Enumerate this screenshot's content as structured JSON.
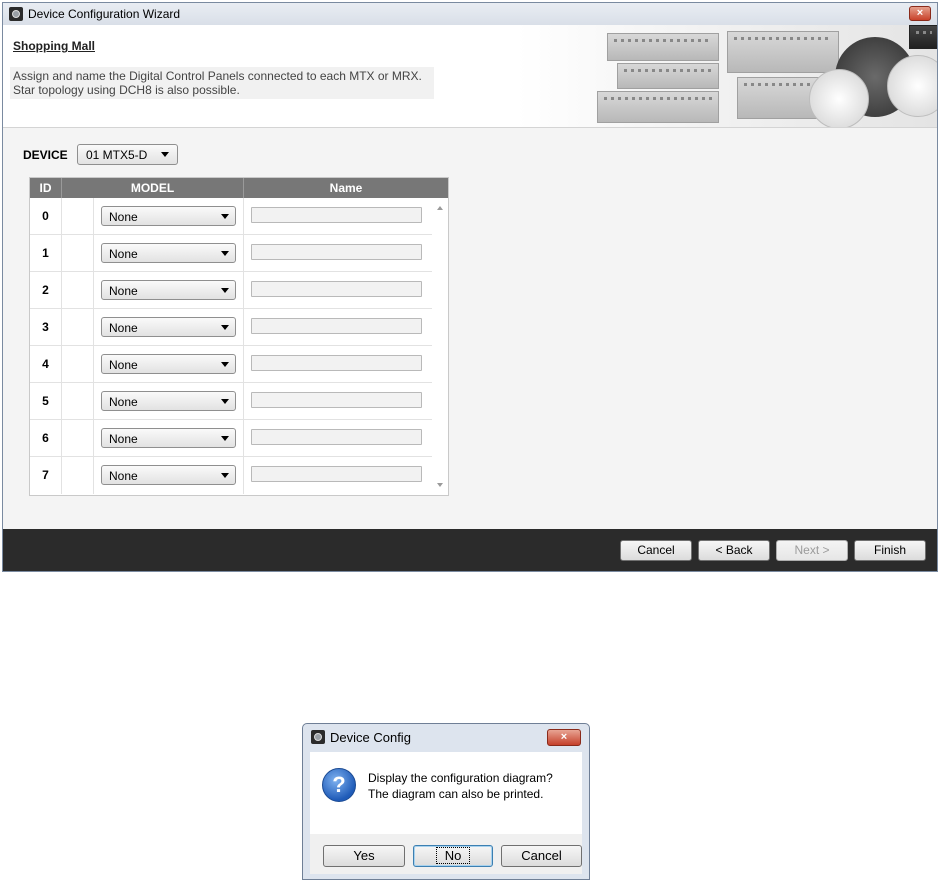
{
  "wizard": {
    "title": "Device Configuration Wizard",
    "close_label": "×",
    "page_title": "Shopping Mall",
    "description_line1": "Assign and name the Digital Control Panels connected to each MTX or MRX.",
    "description_line2": "Star topology using DCH8 is also possible.",
    "device_label": "DEVICE",
    "device_value": "01 MTX5-D",
    "table": {
      "columns": [
        "ID",
        "MODEL",
        "Name"
      ],
      "rows": [
        {
          "id": "0",
          "model": "None",
          "name": ""
        },
        {
          "id": "1",
          "model": "None",
          "name": ""
        },
        {
          "id": "2",
          "model": "None",
          "name": ""
        },
        {
          "id": "3",
          "model": "None",
          "name": ""
        },
        {
          "id": "4",
          "model": "None",
          "name": ""
        },
        {
          "id": "5",
          "model": "None",
          "name": ""
        },
        {
          "id": "6",
          "model": "None",
          "name": ""
        },
        {
          "id": "7",
          "model": "None",
          "name": ""
        }
      ]
    },
    "buttons": {
      "cancel": "Cancel",
      "back": "< Back",
      "next": "Next >",
      "finish": "Finish"
    }
  },
  "dialog": {
    "title": "Device Config",
    "close_label": "×",
    "icon": "question-icon",
    "message_line1": "Display the configuration diagram?",
    "message_line2": "The diagram can also be printed.",
    "buttons": {
      "yes": "Yes",
      "no": "No",
      "cancel": "Cancel"
    }
  }
}
